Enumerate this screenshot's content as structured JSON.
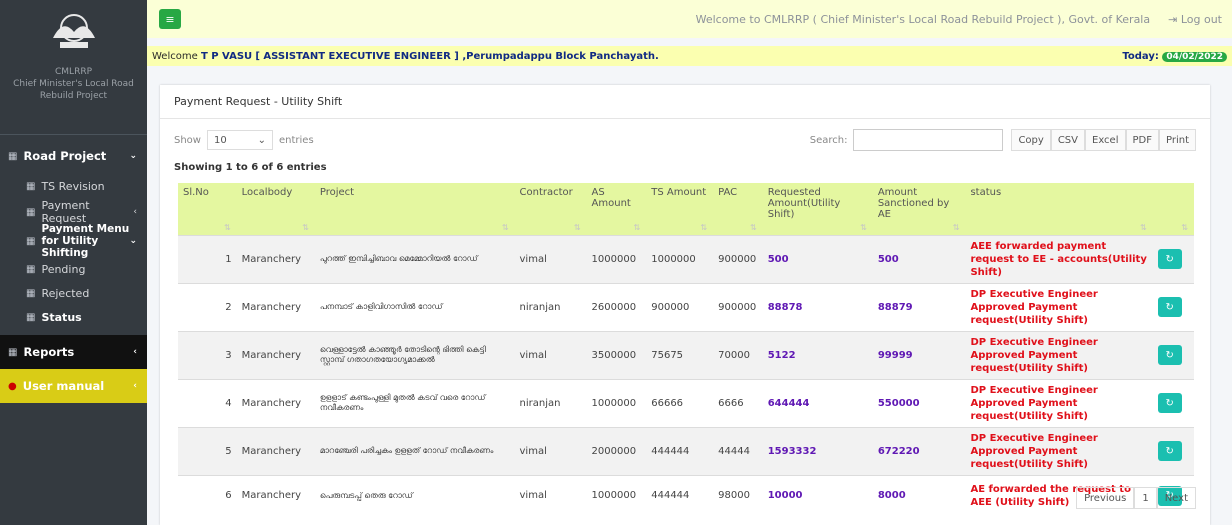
{
  "sidebar": {
    "brand_short": "CMLRRP",
    "brand_full": "Chief Minister's Local Road Rebuild Project",
    "items": [
      {
        "label": "Road Project",
        "icon": "table-icon"
      },
      {
        "label": "TS Revision",
        "icon": "table-icon"
      },
      {
        "label": "Payment Request",
        "icon": "table-icon"
      },
      {
        "label": "Payment Menu for Utility Shifting",
        "icon": "table-icon"
      },
      {
        "label": "Pending",
        "icon": "table-icon"
      },
      {
        "label": "Rejected",
        "icon": "table-icon"
      },
      {
        "label": "Status",
        "icon": "table-icon"
      },
      {
        "label": "Reports",
        "icon": "table-icon"
      },
      {
        "label": "User manual",
        "icon": "help-icon"
      }
    ]
  },
  "topbar": {
    "welcome": "Welcome to CMLRRP ( Chief Minister's Local Road Rebuild Project ), Govt. of Kerala",
    "logout": "Log out"
  },
  "userbar": {
    "prefix": "Welcome",
    "user": "T P VASU",
    "role": "[ ASSISTANT EXECUTIVE ENGINEER ] ,Perumpadappu Block Panchayath.",
    "today_label": "Today:",
    "date": "04/02/2022"
  },
  "card": {
    "title": "Payment Request - Utility Shift",
    "show_label": "Show",
    "entries_value": "10",
    "entries_label": "entries",
    "search_label": "Search:",
    "buttons": [
      "Copy",
      "CSV",
      "Excel",
      "PDF",
      "Print"
    ],
    "info": "Showing 1 to 6 of 6 entries"
  },
  "table": {
    "headers": [
      "Sl.No",
      "Localbody",
      "Project",
      "Contractor",
      "AS Amount",
      "TS Amount",
      "PAC",
      "Requested Amount(Utility Shift)",
      "Amount Sanctioned by AE",
      "status",
      ""
    ],
    "rows": [
      {
        "sl": "1",
        "localbody": "Maranchery",
        "project": "പുറത്ത് ഇമ്പിച്ചിബാവ മെമ്മോറിയൽ റോഡ്",
        "contractor": "vimal",
        "as": "1000000",
        "ts": "1000000",
        "pac": "900000",
        "requested": "500",
        "sanctioned": "500",
        "status": "AEE forwarded payment request to EE - accounts(Utility Shift)"
      },
      {
        "sl": "2",
        "localbody": "Maranchery",
        "project": "പനമ്പാട് കാളിവിഗാസിൽ റോഡ്",
        "contractor": "niranjan",
        "as": "2600000",
        "ts": "900000",
        "pac": "900000",
        "requested": "88878",
        "sanctioned": "88879",
        "status": "DP Executive Engineer Approved Payment request(Utility Shift)"
      },
      {
        "sl": "3",
        "localbody": "Maranchery",
        "project": "വെള്ളാട്ടേൽ കാഞ്ഞൂർ തോടിന്റെ ഭിത്തി കെട്ടി സ്റ്റാമ്പ് ഗതാഗതയോഗ്യമാക്കൽ",
        "contractor": "vimal",
        "as": "3500000",
        "ts": "75675",
        "pac": "70000",
        "requested": "5122",
        "sanctioned": "99999",
        "status": "DP Executive Engineer Approved Payment request(Utility Shift)"
      },
      {
        "sl": "4",
        "localbody": "Maranchery",
        "project": "ഉളളാട് കണ്ടംപുള്ളി മുതൽ കടവ് വരെ റോഡ് നവീകരണം",
        "contractor": "niranjan",
        "as": "1000000",
        "ts": "66666",
        "pac": "6666",
        "requested": "644444",
        "sanctioned": "550000",
        "status": "DP Executive Engineer Approved Payment request(Utility Shift)"
      },
      {
        "sl": "5",
        "localbody": "Maranchery",
        "project": "മാറഞ്ചേരി പരിച്ചകം ഉളളത് റോഡ് നവീകരണം",
        "contractor": "vimal",
        "as": "2000000",
        "ts": "444444",
        "pac": "44444",
        "requested": "1593332",
        "sanctioned": "672220",
        "status": "DP Executive Engineer Approved Payment request(Utility Shift)"
      },
      {
        "sl": "6",
        "localbody": "Maranchery",
        "project": "പെരുമ്പടപ്പ് തെരു റോഡ്",
        "contractor": "vimal",
        "as": "1000000",
        "ts": "444444",
        "pac": "98000",
        "requested": "10000",
        "sanctioned": "8000",
        "status": "AE forwarded the request to AEE (Utility Shift)"
      }
    ]
  },
  "pagination": {
    "previous": "Previous",
    "page": "1",
    "next": "Next"
  }
}
